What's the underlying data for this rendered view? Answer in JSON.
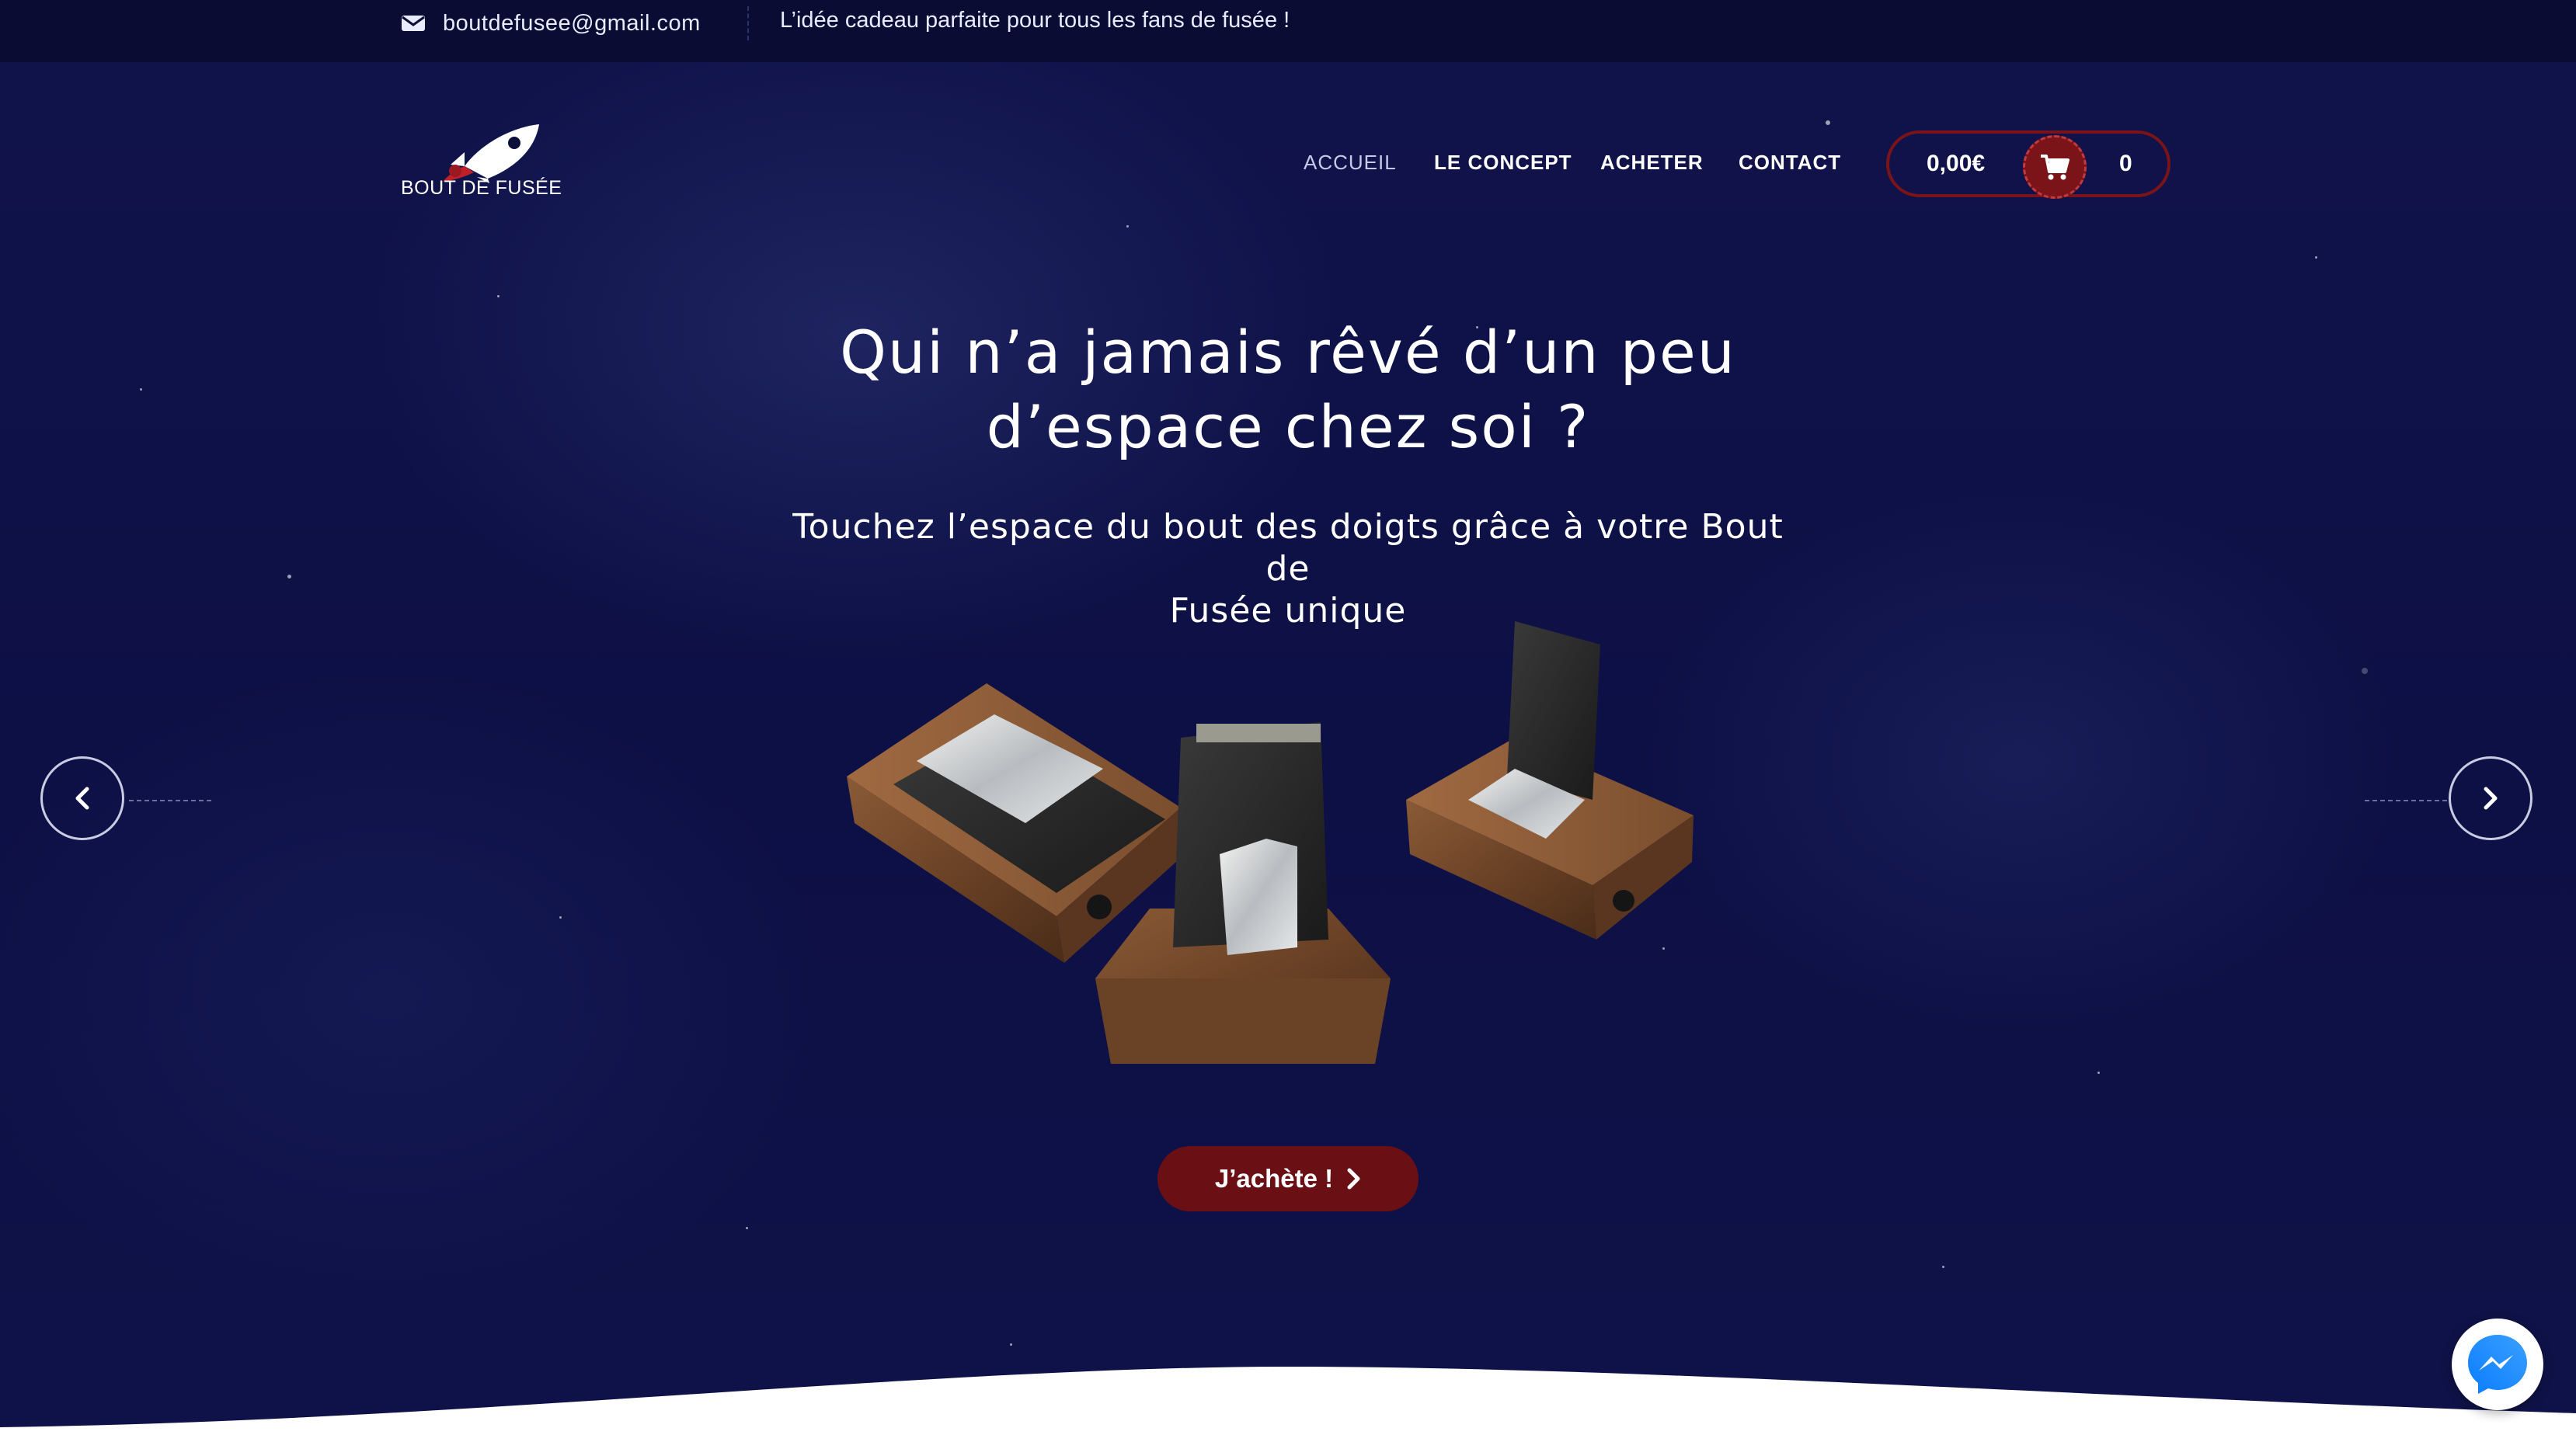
{
  "topbar": {
    "email_icon": "envelope-icon",
    "email": "boutdefusee@gmail.com",
    "tagline": "L’idée cadeau parfaite pour tous les fans de fusée !"
  },
  "brand": {
    "logo_icon": "rocket-icon",
    "name": "BOUT DE FUSÉE"
  },
  "nav": {
    "items": [
      {
        "label": "ACCUEIL",
        "active": true
      },
      {
        "label": "LE CONCEPT",
        "active": false
      },
      {
        "label": "ACHETER",
        "active": false
      },
      {
        "label": "CONTACT",
        "active": false
      }
    ]
  },
  "cart": {
    "total": "0,00€",
    "icon": "shopping-cart-icon",
    "count": "0"
  },
  "hero": {
    "headline_line1": "Qui n’a jamais rêvé d’un peu",
    "headline_line2": "d’espace chez soi ?",
    "subline_line1": "Touchez l’espace du bout des doigts grâce à votre Bout de",
    "subline_line2": "Fusée unique",
    "cta_label": "J’achète !",
    "cta_icon": "chevron-right-icon"
  },
  "slider": {
    "prev_icon": "chevron-left-icon",
    "next_icon": "chevron-right-icon"
  },
  "colors": {
    "background": "#0c0f3a",
    "topbar": "#0a0c33",
    "accent": "#7a1418",
    "button": "#6a1014"
  },
  "chat": {
    "icon": "messenger-icon"
  }
}
